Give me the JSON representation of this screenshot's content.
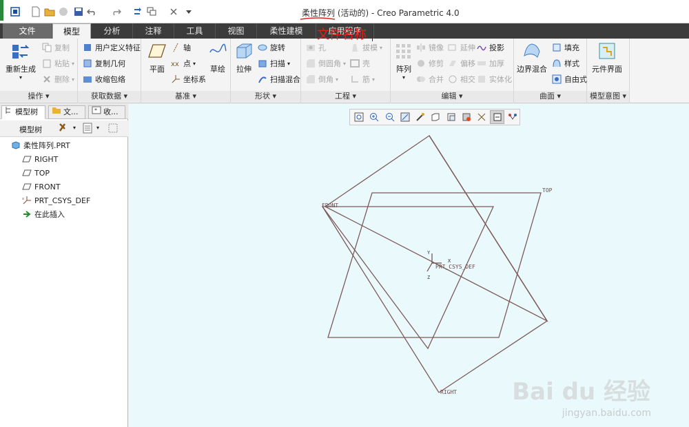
{
  "window": {
    "title_name": "柔性阵列",
    "title_rest": " (活动的) - Creo Parametric 4.0"
  },
  "annotation": {
    "text": "文件名称",
    "color": "#e0201a"
  },
  "tabs": [
    {
      "label": "文件"
    },
    {
      "label": "模型"
    },
    {
      "label": "分析"
    },
    {
      "label": "注释"
    },
    {
      "label": "工具"
    },
    {
      "label": "视图"
    },
    {
      "label": "柔性建模"
    },
    {
      "label": "应用程序"
    }
  ],
  "ribbon": {
    "operations": {
      "label": "操作 ▾",
      "regen": "重新生成",
      "copy": "复制",
      "paste": "粘贴",
      "delete": "删除"
    },
    "get_data": {
      "label": "获取数据 ▾",
      "udf": "用户定义特征",
      "copy_geom": "复制几何",
      "shrinkwrap": "收缩包络"
    },
    "datum": {
      "label": "基准 ▾",
      "plane": "平面",
      "axis": "轴",
      "point": "点",
      "csys": "坐标系",
      "sketch": "草绘"
    },
    "shapes": {
      "label": "形状 ▾",
      "extrude": "拉伸",
      "revolve": "旋转",
      "sweep": "扫描",
      "swept_blend": "扫描混合"
    },
    "engineering": {
      "label": "工程 ▾",
      "hole": "孔",
      "round": "倒圆角",
      "chamfer": "倒角",
      "draft": "拔模",
      "shell": "壳",
      "rib": "筋"
    },
    "editing": {
      "label": "编辑 ▾",
      "pattern": "阵列",
      "mirror": "镜像",
      "trim": "修剪",
      "merge": "合并",
      "extend": "延伸",
      "offset": "偏移",
      "intersect": "相交",
      "project": "投影",
      "thicken": "加厚",
      "solidify": "实体化"
    },
    "surfaces": {
      "label": "曲面 ▾",
      "boundary_blend": "边界混合",
      "fill": "填充",
      "style": "样式",
      "freestyle": "自由式"
    },
    "model_intent": {
      "label": "模型意图 ▾",
      "component_interface": "元件界面"
    }
  },
  "left_panel": {
    "tabs": [
      {
        "label": "模型树"
      },
      {
        "label": "文..."
      },
      {
        "label": "收..."
      }
    ],
    "toolbar_label": "模型树",
    "tree": [
      {
        "label": "柔性阵列.PRT",
        "icon": "part-icon"
      },
      {
        "label": "RIGHT",
        "icon": "datum-plane-icon"
      },
      {
        "label": "TOP",
        "icon": "datum-plane-icon"
      },
      {
        "label": "FRONT",
        "icon": "datum-plane-icon"
      },
      {
        "label": "PRT_CSYS_DEF",
        "icon": "csys-icon"
      },
      {
        "label": "在此插入",
        "icon": "insert-here-arrow-icon"
      }
    ]
  },
  "viewport": {
    "plane_labels": {
      "front": "FRONT",
      "top": "TOP",
      "right": "RIGHT"
    },
    "csys_label": "PRT_CSYS_DEF",
    "axis_x": "X",
    "axis_y": "Y",
    "axis_z": "Z",
    "background": "#eaf9fb",
    "line_color": "#7d5a5a"
  },
  "watermark": {
    "main": "Bai du 经验",
    "sub": "jingyan.baidu.com"
  }
}
